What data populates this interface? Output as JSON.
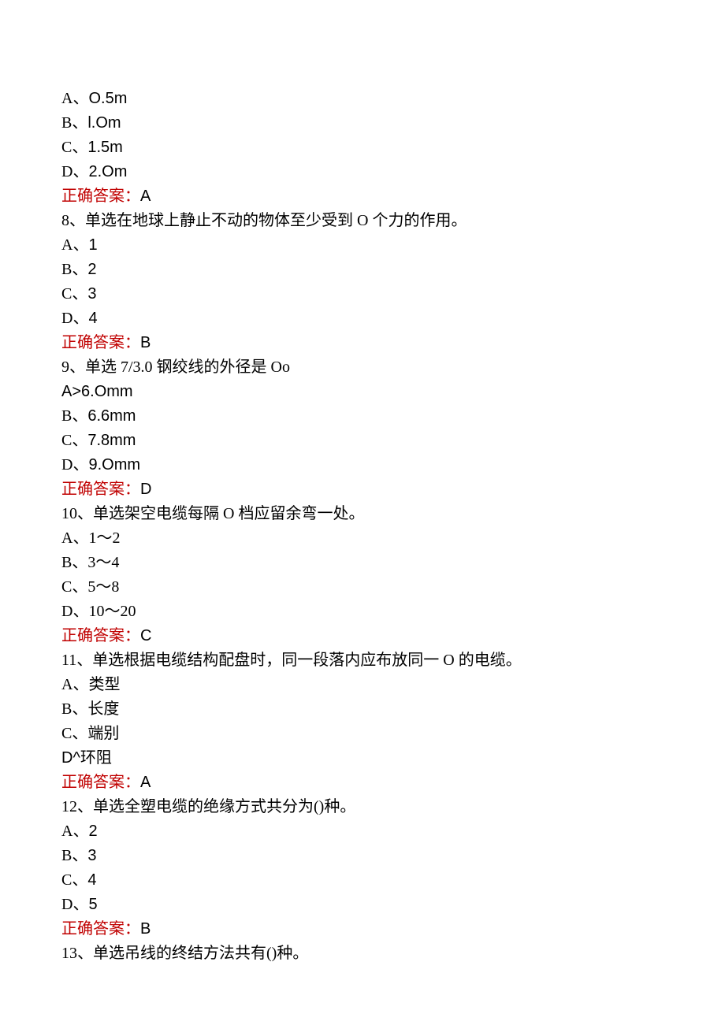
{
  "intro_options": [
    {
      "label": "A、",
      "text": "O.5m"
    },
    {
      "label": "B、",
      "text": "l.Om"
    },
    {
      "label": "C、",
      "text": "1.5m"
    },
    {
      "label": "D、",
      "text": "2.Om"
    }
  ],
  "intro_answer_label": "正确答案：",
  "intro_answer_value": "A",
  "questions": [
    {
      "stem_prefix": "8、",
      "stem": "单选在地球上静止不动的物体至少受到 O 个力的作用。",
      "options": [
        {
          "label": "A、",
          "text": "1"
        },
        {
          "label": "B、",
          "text": "2"
        },
        {
          "label": "C、",
          "text": "3"
        },
        {
          "label": "D、",
          "text": "4"
        }
      ],
      "answer_label": "正确答案：",
      "answer_value": "B"
    },
    {
      "stem_prefix": "9、",
      "stem": "单选 7/3.0 钢绞线的外径是 Oo",
      "options": [
        {
          "label": "A>",
          "text": "6.Omm"
        },
        {
          "label": "B、",
          "text": "6.6mm"
        },
        {
          "label": "C、",
          "text": "7.8mm"
        },
        {
          "label": "D、",
          "text": "9.Omm"
        }
      ],
      "answer_label": "正确答案：",
      "answer_value": "D"
    },
    {
      "stem_prefix": "10、",
      "stem": "单选架空电缆每隔 O 档应留余弯一处。",
      "options": [
        {
          "label": "A、",
          "text": "1〜2"
        },
        {
          "label": "B、",
          "text": "3〜4"
        },
        {
          "label": "C、",
          "text": "5〜8"
        },
        {
          "label": "D、",
          "text": "10〜20"
        }
      ],
      "answer_label": "正确答案：",
      "answer_value": "C"
    },
    {
      "stem_prefix": "11、",
      "stem": "单选根据电缆结构配盘时，同一段落内应布放同一 O 的电缆。",
      "options": [
        {
          "label": "A、",
          "text": "类型"
        },
        {
          "label": "B、",
          "text": "长度"
        },
        {
          "label": "C、",
          "text": "端别"
        },
        {
          "label": "D^",
          "text": "环阻"
        }
      ],
      "answer_label": "正确答案：",
      "answer_value": "A"
    },
    {
      "stem_prefix": "12、",
      "stem": "单选全塑电缆的绝缘方式共分为()种。",
      "options": [
        {
          "label": "A、",
          "text": "2"
        },
        {
          "label": "B、",
          "text": "3"
        },
        {
          "label": "C、",
          "text": "4"
        },
        {
          "label": "D、",
          "text": "5"
        }
      ],
      "answer_label": "正确答案：",
      "answer_value": "B"
    },
    {
      "stem_prefix": "13、",
      "stem": "单选吊线的终结方法共有()种。",
      "options": [],
      "answer_label": "",
      "answer_value": ""
    }
  ]
}
